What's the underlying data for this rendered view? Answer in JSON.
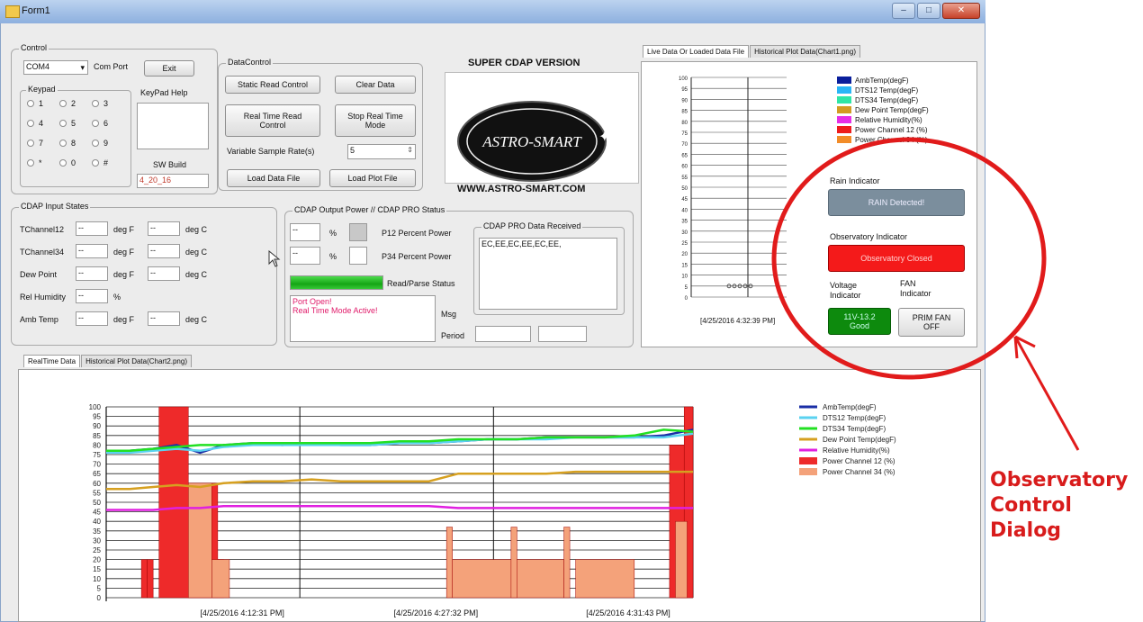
{
  "window": {
    "title": "Form1"
  },
  "control": {
    "group_label": "Control",
    "com_port_value": "COM4",
    "com_port_label": "Com Port",
    "exit_label": "Exit",
    "keypad_label": "Keypad",
    "keypad_keys": [
      "1",
      "2",
      "3",
      "4",
      "5",
      "6",
      "7",
      "8",
      "9",
      "*",
      "0",
      "#"
    ],
    "keypad_help_label": "KeyPad Help",
    "sw_build_label": "SW Build",
    "sw_build_value": "4_20_16"
  },
  "data_control": {
    "group_label": "DataControl",
    "static_read_label": "Static Read Control",
    "clear_data_label": "Clear Data",
    "real_time_read_label": "Real Time Read Control",
    "stop_real_time_label": "Stop Real Time Mode",
    "variable_sample_label": "Variable Sample Rate(s)",
    "variable_sample_value": "5",
    "load_data_label": "Load Data File",
    "load_plot_label": "Load Plot File"
  },
  "logo": {
    "title": "SUPER CDAP VERSION",
    "brand": "ASTRO-SMART",
    "url": "WWW.ASTRO-SMART.COM"
  },
  "inputs": {
    "group_label": "CDAP Input States",
    "rows": [
      {
        "label": "TChannel12",
        "f": "--",
        "f_unit": "deg F",
        "c": "--",
        "c_unit": "deg C"
      },
      {
        "label": "TChannel34",
        "f": "--",
        "f_unit": "deg F",
        "c": "--",
        "c_unit": "deg C"
      },
      {
        "label": "Dew Point",
        "f": "--",
        "f_unit": "deg F",
        "c": "--",
        "c_unit": "deg C"
      },
      {
        "label": "Rel Humidity",
        "f": "--",
        "f_unit": "%",
        "c": "",
        "c_unit": ""
      },
      {
        "label": "Amb Temp",
        "f": "--",
        "f_unit": "deg F",
        "c": "--",
        "c_unit": "deg C"
      }
    ]
  },
  "output": {
    "group_label": "CDAP Output Power  //  CDAP PRO Status",
    "p12_value": "--",
    "p12_unit": "%",
    "p12_label": "P12 Percent Power",
    "p34_value": "--",
    "p34_unit": "%",
    "p34_label": "P34 Percent Power",
    "read_parse_label": "Read/Parse Status",
    "read_parse_progress": 1.0,
    "status_lines": [
      "Port Open!",
      "Real Time Mode Active!"
    ],
    "msg_label": "Msg",
    "period_label": "Period",
    "pro_group_label": "CDAP PRO Data Received",
    "pro_data_value": "EC,EE,EC,EE,EC,EE,"
  },
  "right_panel": {
    "tabs": [
      "Live Data Or Loaded Data File",
      "Historical Plot Data(Chart1.png)"
    ],
    "active_tab": 0,
    "legend": [
      {
        "name": "AmbTemp(degF)",
        "color": "#0a1f9c"
      },
      {
        "name": "DTS12 Temp(degF)",
        "color": "#29b6f6"
      },
      {
        "name": "DTS34 Temp(degF)",
        "color": "#2ee6a6"
      },
      {
        "name": "Dew Point Temp(degF)",
        "color": "#d39b23"
      },
      {
        "name": "Relative Humidity(%)",
        "color": "#e62ee6"
      },
      {
        "name": "Power Channel 12 (%)",
        "color": "#ee1c1c"
      },
      {
        "name": "Power Channel 34 (%)",
        "color": "#f28c28"
      }
    ],
    "rain_label": "Rain Indicator",
    "rain_button": "RAIN Detected!",
    "observatory_label": "Observatory Indicator",
    "observatory_button": "Observatory Closed",
    "voltage_label": "Voltage Indicator",
    "voltage_button": "11V-13.2 Good",
    "fan_label": "FAN Indicator",
    "fan_button": "PRIM FAN OFF",
    "mini_x_label": "[4/25/2016 4:32:39 PM]",
    "mini_ticks": [
      "100",
      "95",
      "90",
      "85",
      "80",
      "75",
      "70",
      "65",
      "60",
      "55",
      "50",
      "45",
      "40",
      "35",
      "30",
      "25",
      "20",
      "15",
      "10",
      "5",
      "0"
    ]
  },
  "bottom": {
    "tabs": [
      "RealTime Data",
      "Historical Plot Data(Chart2.png)"
    ],
    "active_tab": 0
  },
  "chart_data": {
    "type": "line",
    "ylim": [
      0,
      100
    ],
    "yticks": [
      100,
      95,
      90,
      85,
      80,
      75,
      70,
      65,
      60,
      55,
      50,
      45,
      40,
      35,
      30,
      25,
      20,
      15,
      10,
      5,
      0
    ],
    "x_labels": [
      "[4/25/2016 4:12:31 PM]",
      "[4/25/2016 4:27:32 PM]",
      "[4/25/2016 4:31:43 PM]"
    ],
    "x": [
      0,
      0.04,
      0.08,
      0.12,
      0.16,
      0.2,
      0.25,
      0.3,
      0.35,
      0.4,
      0.45,
      0.5,
      0.55,
      0.6,
      0.65,
      0.7,
      0.75,
      0.8,
      0.85,
      0.9,
      0.95,
      1.0
    ],
    "series": [
      {
        "name": "AmbTemp(degF)",
        "color": "#1a2ea6",
        "values": [
          77,
          77,
          78,
          80,
          76,
          80,
          81,
          80,
          81,
          80,
          80,
          81,
          81,
          82,
          83,
          83,
          84,
          84,
          84,
          84,
          85,
          88
        ]
      },
      {
        "name": "DTS12 Temp(degF)",
        "color": "#5ad2f0",
        "values": [
          76,
          76,
          77,
          78,
          77,
          79,
          80,
          80,
          80,
          80,
          80,
          81,
          81,
          82,
          83,
          83,
          83,
          84,
          84,
          84,
          84,
          86
        ]
      },
      {
        "name": "DTS34 Temp(degF)",
        "color": "#22e022",
        "values": [
          77,
          77,
          78,
          79,
          80,
          80,
          81,
          81,
          81,
          81,
          81,
          82,
          82,
          83,
          83,
          83,
          84,
          84,
          84,
          85,
          88,
          87
        ]
      },
      {
        "name": "Dew Point Temp(degF)",
        "color": "#d6a020",
        "values": [
          57,
          57,
          58,
          59,
          58,
          60,
          61,
          61,
          62,
          61,
          61,
          61,
          61,
          65,
          65,
          65,
          65,
          66,
          66,
          66,
          66,
          66
        ]
      },
      {
        "name": "Relative Humidity(%)",
        "color": "#e020e0",
        "values": [
          46,
          46,
          46,
          47,
          47,
          48,
          48,
          48,
          48,
          48,
          48,
          48,
          48,
          47,
          47,
          47,
          47,
          47,
          47,
          47,
          47,
          47
        ]
      }
    ],
    "bar_series": [
      {
        "name": "Power Channel 12 (%)",
        "color": "#ee2a2a"
      },
      {
        "name": "Power Channel 34 (%)",
        "color": "#f4a27a"
      }
    ],
    "legend": [
      {
        "name": "AmbTemp(degF)",
        "color": "#1a2ea6"
      },
      {
        "name": "DTS12 Temp(degF)",
        "color": "#5ad2f0"
      },
      {
        "name": "DTS34 Temp(degF)",
        "color": "#22e022"
      },
      {
        "name": "Dew Point Temp(degF)",
        "color": "#d6a020"
      },
      {
        "name": "Relative Humidity(%)",
        "color": "#e020e0"
      },
      {
        "name": "Power Channel 12 (%)",
        "color": "#ee2a2a"
      },
      {
        "name": "Power Channel 34 (%)",
        "color": "#f4a27a"
      }
    ]
  },
  "annotation": {
    "lines": [
      "Observatory",
      "Control",
      "Dialog"
    ],
    "color": "#d81b1b"
  }
}
